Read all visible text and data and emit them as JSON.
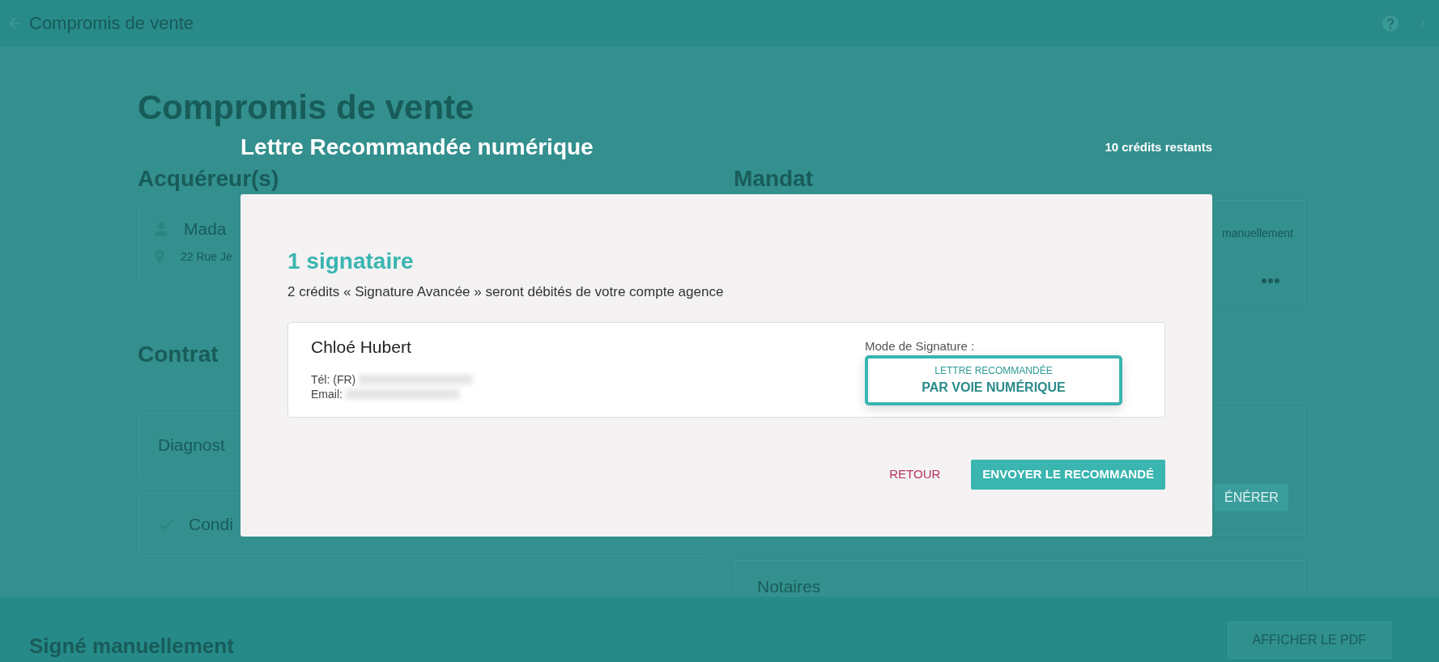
{
  "app_bar": {
    "title": "Compromis de vente"
  },
  "background": {
    "heading": "Compromis de vente",
    "buyers": {
      "title": "Acquéreur(s)",
      "name": "Mada",
      "address": "22 Rue Je"
    },
    "mandate": {
      "title": "Mandat",
      "status": "manuellement"
    },
    "contract": {
      "title": "Contrat",
      "items": [
        {
          "label": "Diagnost",
          "checked": false
        },
        {
          "label": "Condi",
          "checked": true
        }
      ]
    },
    "generate_button": "ÉNÉRER",
    "notaries": {
      "title": "Notaires"
    }
  },
  "bottom_bar": {
    "title": "Signé manuellement",
    "pdf_button": "AFFICHER LE PDF"
  },
  "dialog": {
    "title": "Lettre Recommandée numérique",
    "credits": "10 crédits restants",
    "signer_count": "1 signataire",
    "notice": "2 crédits « Signature Avancée » seront débités de votre compte agence",
    "signers": [
      {
        "name": "Chloé Hubert",
        "phone_label": "Tél: (FR)",
        "email_label": "Email:",
        "mode_label": "Mode de Signature :",
        "mode_line1": "LETTRE RECOMMANDÉE",
        "mode_line2": "PAR VOIE NUMÉRIQUE"
      }
    ],
    "buttons": {
      "back": "RETOUR",
      "send": "ENVOYER LE RECOMMANDÉ"
    }
  }
}
